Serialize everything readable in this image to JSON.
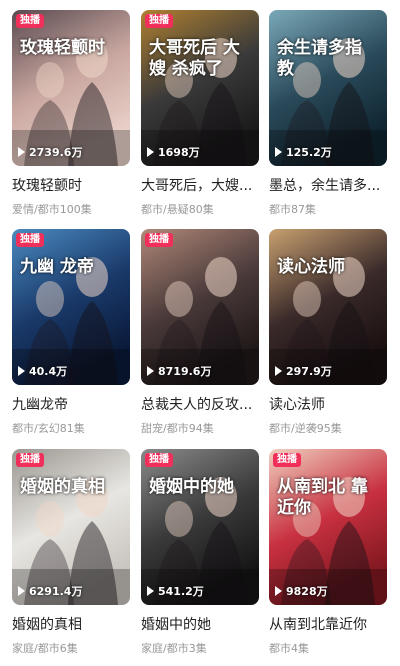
{
  "items": [
    {
      "title": "玫瑰轻颤时",
      "poster_text": "玫瑰轻颤时",
      "badge": "独播",
      "plays": "2739.6万",
      "meta": "爱情/都市100集",
      "colors": [
        "#c9a7a0",
        "#5a4a50",
        "#e8d0c8"
      ]
    },
    {
      "title": "大哥死后，大嫂...",
      "poster_text": "大哥死后 大嫂 杀疯了",
      "badge": "独播",
      "plays": "1698万",
      "meta": "都市/悬疑80集",
      "colors": [
        "#3a3a3a",
        "#b08030",
        "#1a1a1a"
      ]
    },
    {
      "title": "墨总，余生请多...",
      "poster_text": "余生请多指教",
      "badge": "",
      "plays": "125.2万",
      "meta": "都市87集",
      "colors": [
        "#2a4a5a",
        "#7aa8b8",
        "#0f2530"
      ]
    },
    {
      "title": "九幽龙帝",
      "poster_text": "九幽 龙帝",
      "badge": "独播",
      "plays": "40.4万",
      "meta": "都市/玄幻81集",
      "colors": [
        "#1a3a6a",
        "#4a8ac0",
        "#0a1a3a"
      ]
    },
    {
      "title": "总裁夫人的反攻...",
      "poster_text": "",
      "badge": "独播",
      "plays": "8719.6万",
      "meta": "甜宠/都市94集",
      "colors": [
        "#4a3a3a",
        "#b08878",
        "#201818"
      ]
    },
    {
      "title": "读心法师",
      "poster_text": "读心法师",
      "badge": "",
      "plays": "297.9万",
      "meta": "都市/逆袭95集",
      "colors": [
        "#3a2a2a",
        "#c8a070",
        "#1a1010"
      ]
    },
    {
      "title": "婚姻的真相",
      "poster_text": "婚姻的真相",
      "badge": "独播",
      "plays": "6291.4万",
      "meta": "家庭/都市6集",
      "colors": [
        "#e8e6e2",
        "#9a9690",
        "#c8c4be"
      ]
    },
    {
      "title": "婚姻中的她",
      "poster_text": "婚姻中的她",
      "badge": "独播",
      "plays": "541.2万",
      "meta": "家庭/都市3集",
      "colors": [
        "#3a3a3a",
        "#8a8a8a",
        "#151515"
      ]
    },
    {
      "title": "从南到北靠近你",
      "poster_text": "从南到北 靠近你",
      "badge": "独播",
      "plays": "9828万",
      "meta": "都市4集",
      "colors": [
        "#c83040",
        "#f0d0c0",
        "#801820"
      ]
    }
  ],
  "icons": {
    "play": "play-icon"
  },
  "accent": "#f0305a"
}
